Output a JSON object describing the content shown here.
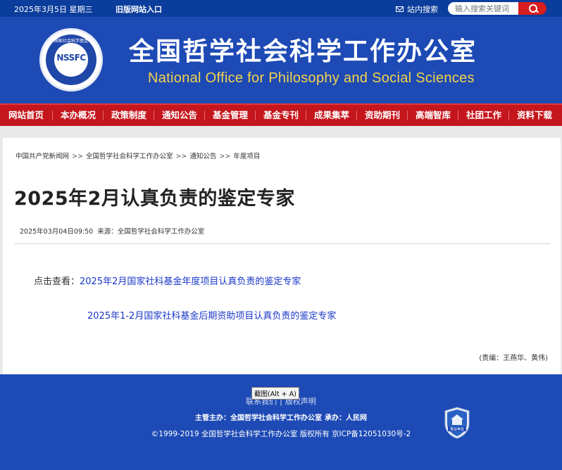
{
  "topbar": {
    "date": "2025年3月5日 星期三",
    "old_site": "旧版网站入口",
    "site_search": "站内搜索",
    "search_placeholder": "输入搜索关键词"
  },
  "header": {
    "logo_text": "NSSFC",
    "logo_arc": "国家社会科学基金",
    "title_cn": "全国哲学社会科学工作办公室",
    "title_en": "National Office for Philosophy and Social Sciences"
  },
  "nav": {
    "items": [
      {
        "label": "网站首页"
      },
      {
        "label": "本办概况"
      },
      {
        "label": "政策制度"
      },
      {
        "label": "通知公告"
      },
      {
        "label": "基金管理"
      },
      {
        "label": "基金专刊"
      },
      {
        "label": "成果集萃"
      },
      {
        "label": "资助期刊"
      },
      {
        "label": "高端智库"
      },
      {
        "label": "社团工作"
      },
      {
        "label": "资料下载"
      }
    ]
  },
  "breadcrumb": {
    "items": [
      "中国共产党新闻网",
      "全国哲学社会科学工作办公室",
      "通知公告",
      "年度项目"
    ],
    "sep": ">>"
  },
  "article": {
    "title": "2025年2月认真负责的鉴定专家",
    "datetime": "2025年03月04日09:50",
    "source_label": "来源：",
    "source": "全国哲学社会科学工作办公室",
    "click_prefix": "点击查看：",
    "link1": "2025年2月国家社科基金年度项目认真负责的鉴定专家",
    "link2": "2025年1-2月国家社科基金后期资助项目认真负责的鉴定专家",
    "editor": "(责编：王燕华、黄伟)"
  },
  "footer": {
    "contact": "联系我们",
    "sep": "|",
    "copyright_statement": "版权声明",
    "sponsor_label": "主管主办：",
    "sponsor": "全国哲学社会科学工作办公室",
    "host_label": "承办：",
    "host": "人民网",
    "copyright": "©1999-2019 全国哲学社会科学工作办公室 版权所有 京ICP备12051030号-2",
    "badge_label": "事业单位"
  },
  "tooltip": "截图(Alt + A)",
  "colors": {
    "header_blue": "#1d4ab5",
    "topbar_blue": "#0b3d9c",
    "nav_red": "#c5161d",
    "link_blue": "#1a37c7",
    "title_en_yellow": "#f5d34a"
  }
}
